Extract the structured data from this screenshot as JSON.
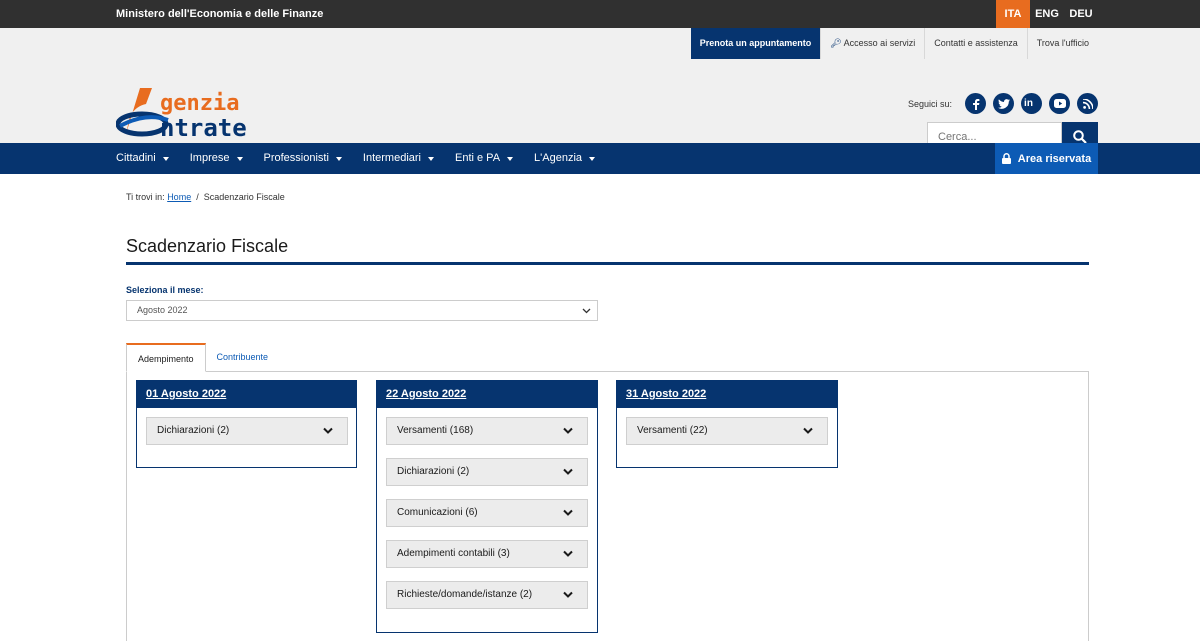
{
  "topbar": {
    "ministry": "Ministero dell'Economia e delle Finanze",
    "languages": [
      "ITA",
      "ENG",
      "DEU"
    ],
    "active_language": "ITA"
  },
  "header": {
    "links": {
      "prenota": "Prenota un appuntamento",
      "accesso": "Accesso ai servizi",
      "contatti": "Contatti e assistenza",
      "trova": "Trova l'ufficio"
    },
    "logo": {
      "line1": "genzia",
      "line2": "ntrate",
      "logo_letter_1": "A",
      "logo_letter_2": "E"
    },
    "follow_label": "Seguici su:",
    "social_icons": [
      "facebook-icon",
      "twitter-icon",
      "linkedin-icon",
      "youtube-icon",
      "rss-icon"
    ],
    "search_placeholder": "Cerca..."
  },
  "nav": {
    "items": [
      "Cittadini",
      "Imprese",
      "Professionisti",
      "Intermediari",
      "Enti e PA",
      "L'Agenzia"
    ],
    "area_riservata": "Area riservata"
  },
  "breadcrumb": {
    "prefix": "Ti trovi in:",
    "home": "Home",
    "sep": "/",
    "current": "Scadenzario Fiscale"
  },
  "page": {
    "title": "Scadenzario Fiscale",
    "select_label": "Seleziona il mese:",
    "select_value": "Agosto 2022"
  },
  "tabs": {
    "adempimento": "Adempimento",
    "contribuente": "Contribuente",
    "active": "Adempimento"
  },
  "cards": [
    {
      "date": "01 Agosto 2022",
      "items": [
        "Dichiarazioni (2)"
      ]
    },
    {
      "date": "22 Agosto 2022",
      "items": [
        "Versamenti (168)",
        "Dichiarazioni (2)",
        "Comunicazioni (6)",
        "Adempimenti contabili (3)",
        "Richieste/domande/istanze (2)"
      ]
    },
    {
      "date": "31 Agosto 2022",
      "items": [
        "Versamenti (22)"
      ]
    }
  ],
  "colors": {
    "primary": "#06346f",
    "accent": "#e86c1f",
    "area": "#0d5bb5"
  }
}
